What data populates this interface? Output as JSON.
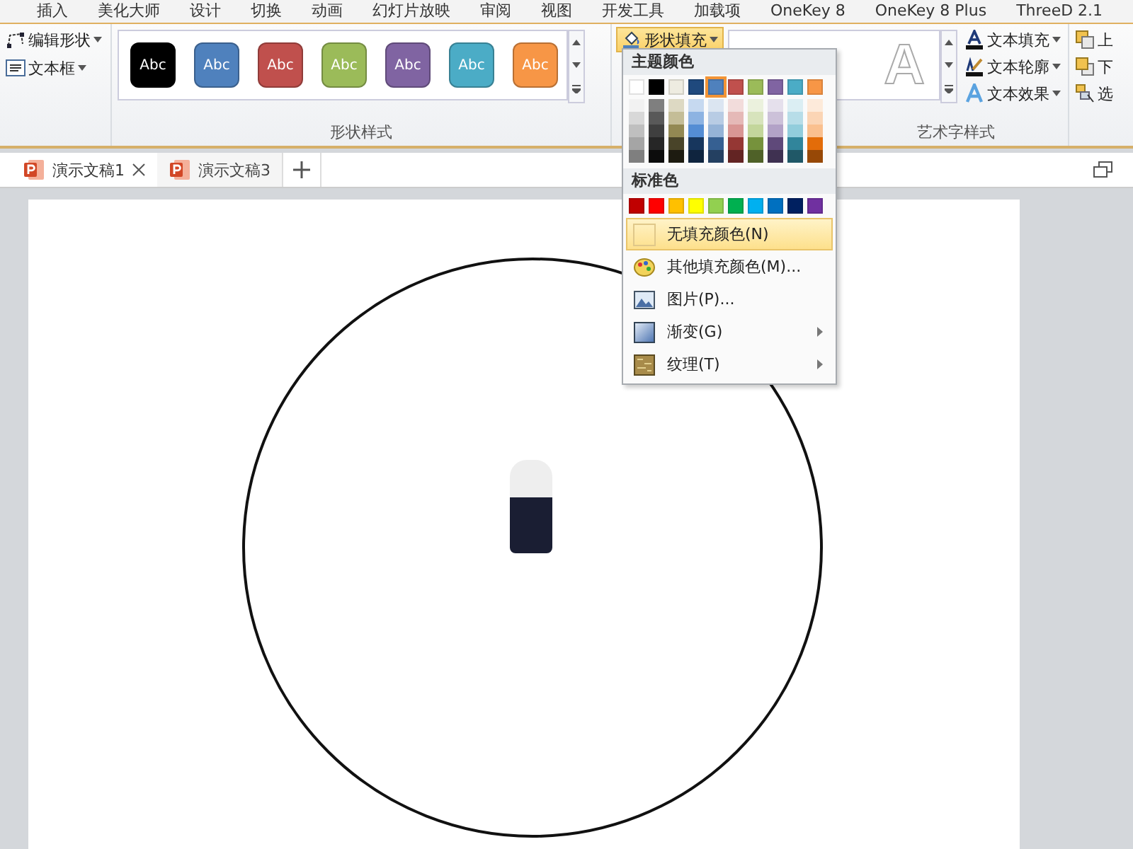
{
  "ribbon_tabs": [
    "插入",
    "美化大师",
    "设计",
    "切换",
    "动画",
    "幻灯片放映",
    "审阅",
    "视图",
    "开发工具",
    "加载项",
    "OneKey 8",
    "OneKey 8 Plus",
    "ThreeD 2.1"
  ],
  "insert_shapes": [
    {
      "label": "编辑形状",
      "kind": "edit"
    },
    {
      "label": "文本框",
      "kind": "textbox"
    }
  ],
  "shape_styles": {
    "label": "形状样式",
    "swatches": [
      {
        "text": "Abc",
        "color": "#000000"
      },
      {
        "text": "Abc",
        "color": "#4f81bd"
      },
      {
        "text": "Abc",
        "color": "#c0504d"
      },
      {
        "text": "Abc",
        "color": "#9bbb59"
      },
      {
        "text": "Abc",
        "color": "#8064a2"
      },
      {
        "text": "Abc",
        "color": "#4bacc6"
      },
      {
        "text": "Abc",
        "color": "#f79646"
      }
    ]
  },
  "shape_fill_button": {
    "label": "形状填充",
    "open": true
  },
  "wordart_styles": {
    "label": "艺术字样式",
    "samples": [
      {
        "text": "A",
        "kind": "white-outline"
      }
    ],
    "items": [
      {
        "label": "文本填充",
        "kind": "fill"
      },
      {
        "label": "文本轮廓",
        "kind": "outline"
      },
      {
        "label": "文本效果",
        "kind": "effect"
      }
    ]
  },
  "arrange": [
    {
      "label": "上",
      "kind": "forward"
    },
    {
      "label": "下",
      "kind": "backward"
    },
    {
      "label": "选",
      "kind": "select"
    }
  ],
  "fill_menu": {
    "theme_heading": "主题颜色",
    "theme_colors": [
      {
        "color": "#ffffff",
        "selected": false,
        "shades": [
          {
            "color": "#f2f2f2"
          },
          {
            "color": "#d8d8d8"
          },
          {
            "color": "#bfbfbf"
          },
          {
            "color": "#a5a5a5"
          },
          {
            "color": "#7f7f7f"
          }
        ]
      },
      {
        "color": "#000000",
        "selected": false,
        "shades": [
          {
            "color": "#7f7f7f"
          },
          {
            "color": "#595959"
          },
          {
            "color": "#3f3f3f"
          },
          {
            "color": "#262626"
          },
          {
            "color": "#0c0c0c"
          }
        ]
      },
      {
        "color": "#eeece1",
        "selected": false,
        "shades": [
          {
            "color": "#ddd9c3"
          },
          {
            "color": "#c4bd97"
          },
          {
            "color": "#938953"
          },
          {
            "color": "#494429"
          },
          {
            "color": "#1d1b10"
          }
        ]
      },
      {
        "color": "#1f497d",
        "selected": false,
        "shades": [
          {
            "color": "#c6d9f0"
          },
          {
            "color": "#8db3e2"
          },
          {
            "color": "#548dd4"
          },
          {
            "color": "#17365d"
          },
          {
            "color": "#0f243e"
          }
        ]
      },
      {
        "color": "#4f81bd",
        "selected": true,
        "shades": [
          {
            "color": "#dbe5f1"
          },
          {
            "color": "#b8cce4"
          },
          {
            "color": "#95b3d7"
          },
          {
            "color": "#366092"
          },
          {
            "color": "#244061"
          }
        ]
      },
      {
        "color": "#c0504d",
        "selected": false,
        "shades": [
          {
            "color": "#f2dcdb"
          },
          {
            "color": "#e5b9b7"
          },
          {
            "color": "#d99694"
          },
          {
            "color": "#953734"
          },
          {
            "color": "#632423"
          }
        ]
      },
      {
        "color": "#9bbb59",
        "selected": false,
        "shades": [
          {
            "color": "#ebf1dd"
          },
          {
            "color": "#d7e3bc"
          },
          {
            "color": "#c3d69b"
          },
          {
            "color": "#76923c"
          },
          {
            "color": "#4f6128"
          }
        ]
      },
      {
        "color": "#8064a2",
        "selected": false,
        "shades": [
          {
            "color": "#e5e0ec"
          },
          {
            "color": "#ccc1d9"
          },
          {
            "color": "#b2a2c7"
          },
          {
            "color": "#5f497a"
          },
          {
            "color": "#3f3151"
          }
        ]
      },
      {
        "color": "#4bacc6",
        "selected": false,
        "shades": [
          {
            "color": "#dbeef3"
          },
          {
            "color": "#b7dde8"
          },
          {
            "color": "#92cddc"
          },
          {
            "color": "#31859b"
          },
          {
            "color": "#205867"
          }
        ]
      },
      {
        "color": "#f79646",
        "selected": false,
        "shades": [
          {
            "color": "#fdeada"
          },
          {
            "color": "#fbd5b5"
          },
          {
            "color": "#fac08f"
          },
          {
            "color": "#e36c09"
          },
          {
            "color": "#974806"
          }
        ]
      }
    ],
    "standard_heading": "标准色",
    "standard_colors": [
      {
        "color": "#c00000"
      },
      {
        "color": "#ff0000"
      },
      {
        "color": "#ffc000"
      },
      {
        "color": "#ffff00"
      },
      {
        "color": "#92d050"
      },
      {
        "color": "#00b050"
      },
      {
        "color": "#00b0f0"
      },
      {
        "color": "#0070c0"
      },
      {
        "color": "#002060"
      },
      {
        "color": "#7030a0"
      }
    ],
    "items": [
      {
        "label": "无填充颜色(N)",
        "kind": "none",
        "highlighted": true,
        "submenu": false
      },
      {
        "label": "其他填充颜色(M)...",
        "kind": "palette",
        "highlighted": false,
        "submenu": false
      },
      {
        "label": "图片(P)...",
        "kind": "picture",
        "highlighted": false,
        "submenu": false
      },
      {
        "label": "渐变(G)",
        "kind": "gradient",
        "highlighted": false,
        "submenu": true
      },
      {
        "label": "纹理(T)",
        "kind": "texture",
        "highlighted": false,
        "submenu": true
      }
    ]
  },
  "doc_tabs": [
    {
      "label": "演示文稿1",
      "selected": true,
      "closable": true
    },
    {
      "label": "演示文稿3",
      "selected": false,
      "closable": false
    }
  ]
}
